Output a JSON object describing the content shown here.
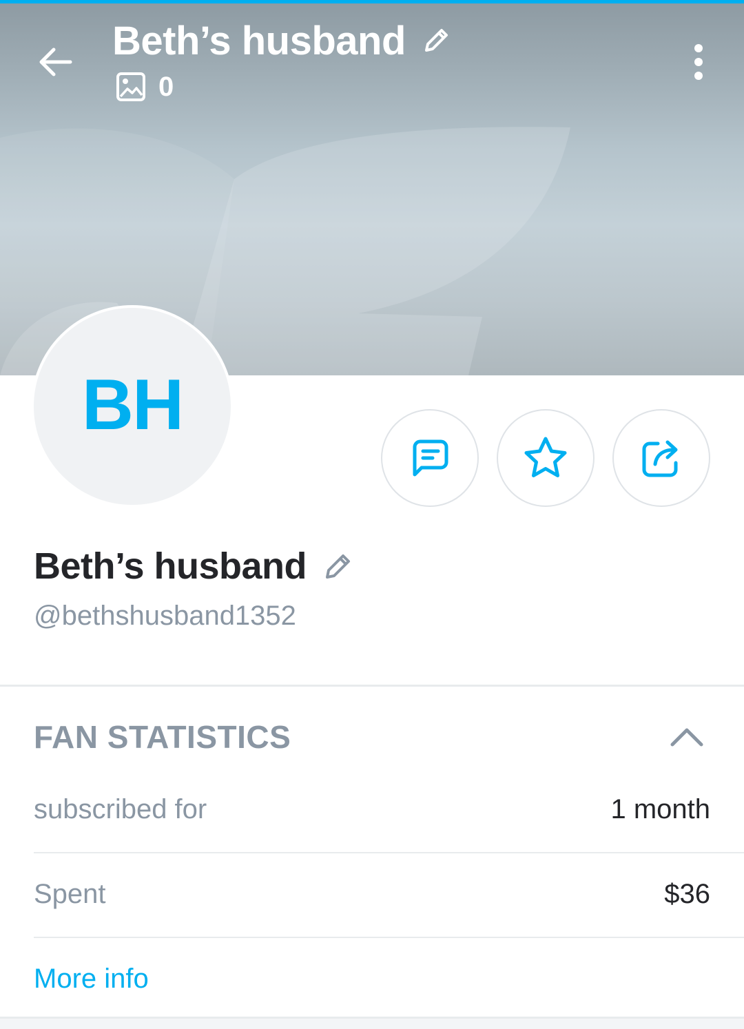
{
  "header": {
    "title": "Beth’s husband",
    "media_count": "0",
    "icons": {
      "back": "back-arrow-icon",
      "edit": "pencil-icon",
      "media": "image-icon",
      "more": "more-vertical-icon"
    }
  },
  "profile": {
    "avatar_initials": "BH",
    "display_name": "Beth’s husband",
    "username": "@bethshusband1352"
  },
  "actions": [
    {
      "name": "message",
      "icon": "message-icon"
    },
    {
      "name": "favorite",
      "icon": "star-icon"
    },
    {
      "name": "share",
      "icon": "share-icon"
    }
  ],
  "fan_statistics": {
    "title": "FAN STATISTICS",
    "toggle_icon": "chevron-up-icon",
    "rows": [
      {
        "label": "subscribed for",
        "value": "1 month"
      },
      {
        "label": "Spent",
        "value": "$36"
      }
    ],
    "more_info": "More info"
  },
  "colors": {
    "accent": "#00aff0",
    "text_primary": "#242529",
    "text_secondary": "#8a96a3",
    "divider": "#e8ebed"
  }
}
